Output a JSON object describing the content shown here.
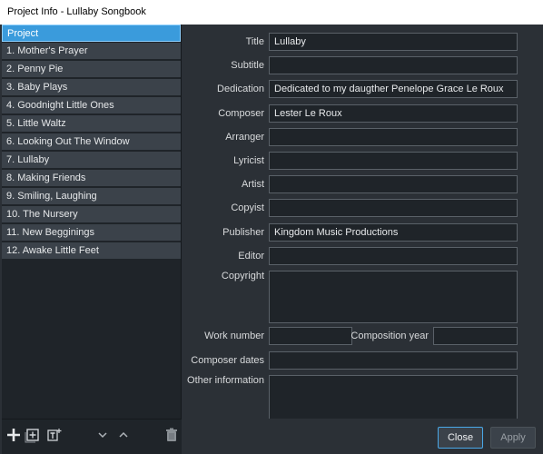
{
  "window": {
    "title": "Project Info - Lullaby Songbook"
  },
  "sidebar": {
    "items": [
      {
        "label": "Project",
        "selected": true
      },
      {
        "label": "1. Mother's Prayer"
      },
      {
        "label": "2. Penny Pie"
      },
      {
        "label": "3. Baby Plays"
      },
      {
        "label": "4. Goodnight Little Ones"
      },
      {
        "label": "5. Little Waltz"
      },
      {
        "label": "6. Looking Out The Window"
      },
      {
        "label": "7. Lullaby"
      },
      {
        "label": "8. Making Friends"
      },
      {
        "label": "9. Smiling, Laughing"
      },
      {
        "label": "10. The Nursery"
      },
      {
        "label": "11. New Begginings"
      },
      {
        "label": "12. Awake Little Feet"
      }
    ],
    "toolbar": {
      "icons": [
        "add-icon",
        "add-box-icon",
        "add-text-icon",
        "move-down-icon",
        "move-up-icon",
        "trash-icon"
      ]
    }
  },
  "form": {
    "title": {
      "label": "Title",
      "value": "Lullaby"
    },
    "subtitle": {
      "label": "Subtitle",
      "value": ""
    },
    "dedication": {
      "label": "Dedication",
      "value": "Dedicated to my daugther Penelope Grace Le Roux"
    },
    "composer": {
      "label": "Composer",
      "value": "Lester Le Roux"
    },
    "arranger": {
      "label": "Arranger",
      "value": ""
    },
    "lyricist": {
      "label": "Lyricist",
      "value": ""
    },
    "artist": {
      "label": "Artist",
      "value": ""
    },
    "copyist": {
      "label": "Copyist",
      "value": ""
    },
    "publisher": {
      "label": "Publisher",
      "value": "Kingdom Music Productions"
    },
    "editor": {
      "label": "Editor",
      "value": ""
    },
    "copyright": {
      "label": "Copyright",
      "value": ""
    },
    "work_number": {
      "label": "Work number",
      "value": ""
    },
    "composition_year": {
      "label": "Composition year",
      "value": ""
    },
    "composer_dates": {
      "label": "Composer dates",
      "value": ""
    },
    "other_information": {
      "label": "Other information",
      "value": ""
    }
  },
  "buttons": {
    "close": "Close",
    "apply": "Apply"
  },
  "colors": {
    "accent": "#3a9bdc",
    "background": "#2b3036",
    "field": "#1f2429"
  }
}
